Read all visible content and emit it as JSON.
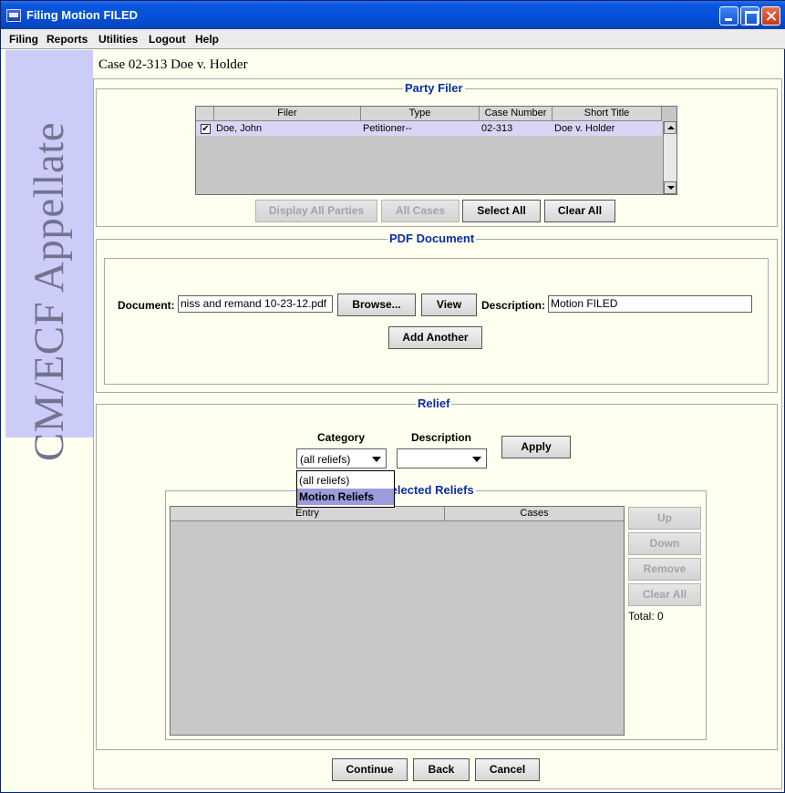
{
  "window": {
    "title": "Filing Motion FILED"
  },
  "menu": [
    "Filing",
    "Reports",
    "Utilities",
    "Logout",
    "Help"
  ],
  "banner": {
    "text": "CM/ECF Appellate"
  },
  "case_title": "Case 02-313 Doe v. Holder",
  "party_filer": {
    "title": "Party Filer",
    "columns": [
      "Filer",
      "Type",
      "Case Number",
      "Short Title"
    ],
    "rows": [
      {
        "checked": true,
        "filer": "Doe, John",
        "type": "Petitioner--",
        "case_number": "02-313",
        "short_title": "Doe v. Holder"
      }
    ],
    "buttons": {
      "display_all": "Display All Parties",
      "all_cases": "All Cases",
      "select_all": "Select All",
      "clear_all": "Clear All"
    }
  },
  "pdf_document": {
    "title": "PDF Document",
    "document_label": "Document:",
    "document_value": "niss and remand 10-23-12.pdf",
    "browse": "Browse...",
    "view": "View",
    "description_label": "Description:",
    "description_value": "Motion FILED",
    "add_another": "Add Another"
  },
  "relief": {
    "title": "Relief",
    "category_label": "Category",
    "description_label": "Description",
    "category_value": "(all reliefs)",
    "description_value": "",
    "apply": "Apply",
    "dropdown_options": [
      "(all reliefs)",
      "Motion Reliefs"
    ],
    "highlighted_option": "Motion Reliefs",
    "selected_reliefs_title": "Selected Reliefs",
    "columns": [
      "Entry",
      "Cases"
    ],
    "side_buttons": {
      "up": "Up",
      "down": "Down",
      "remove": "Remove",
      "clear_all": "Clear All"
    },
    "total": "Total: 0"
  },
  "footer": {
    "continue": "Continue",
    "back": "Back",
    "cancel": "Cancel"
  },
  "colors": {
    "titlebar": "#0550d8",
    "group_title": "#0a2ea8",
    "background": "#fffff0",
    "banner": "#ccccf8",
    "highlight": "#9c9cdc"
  }
}
